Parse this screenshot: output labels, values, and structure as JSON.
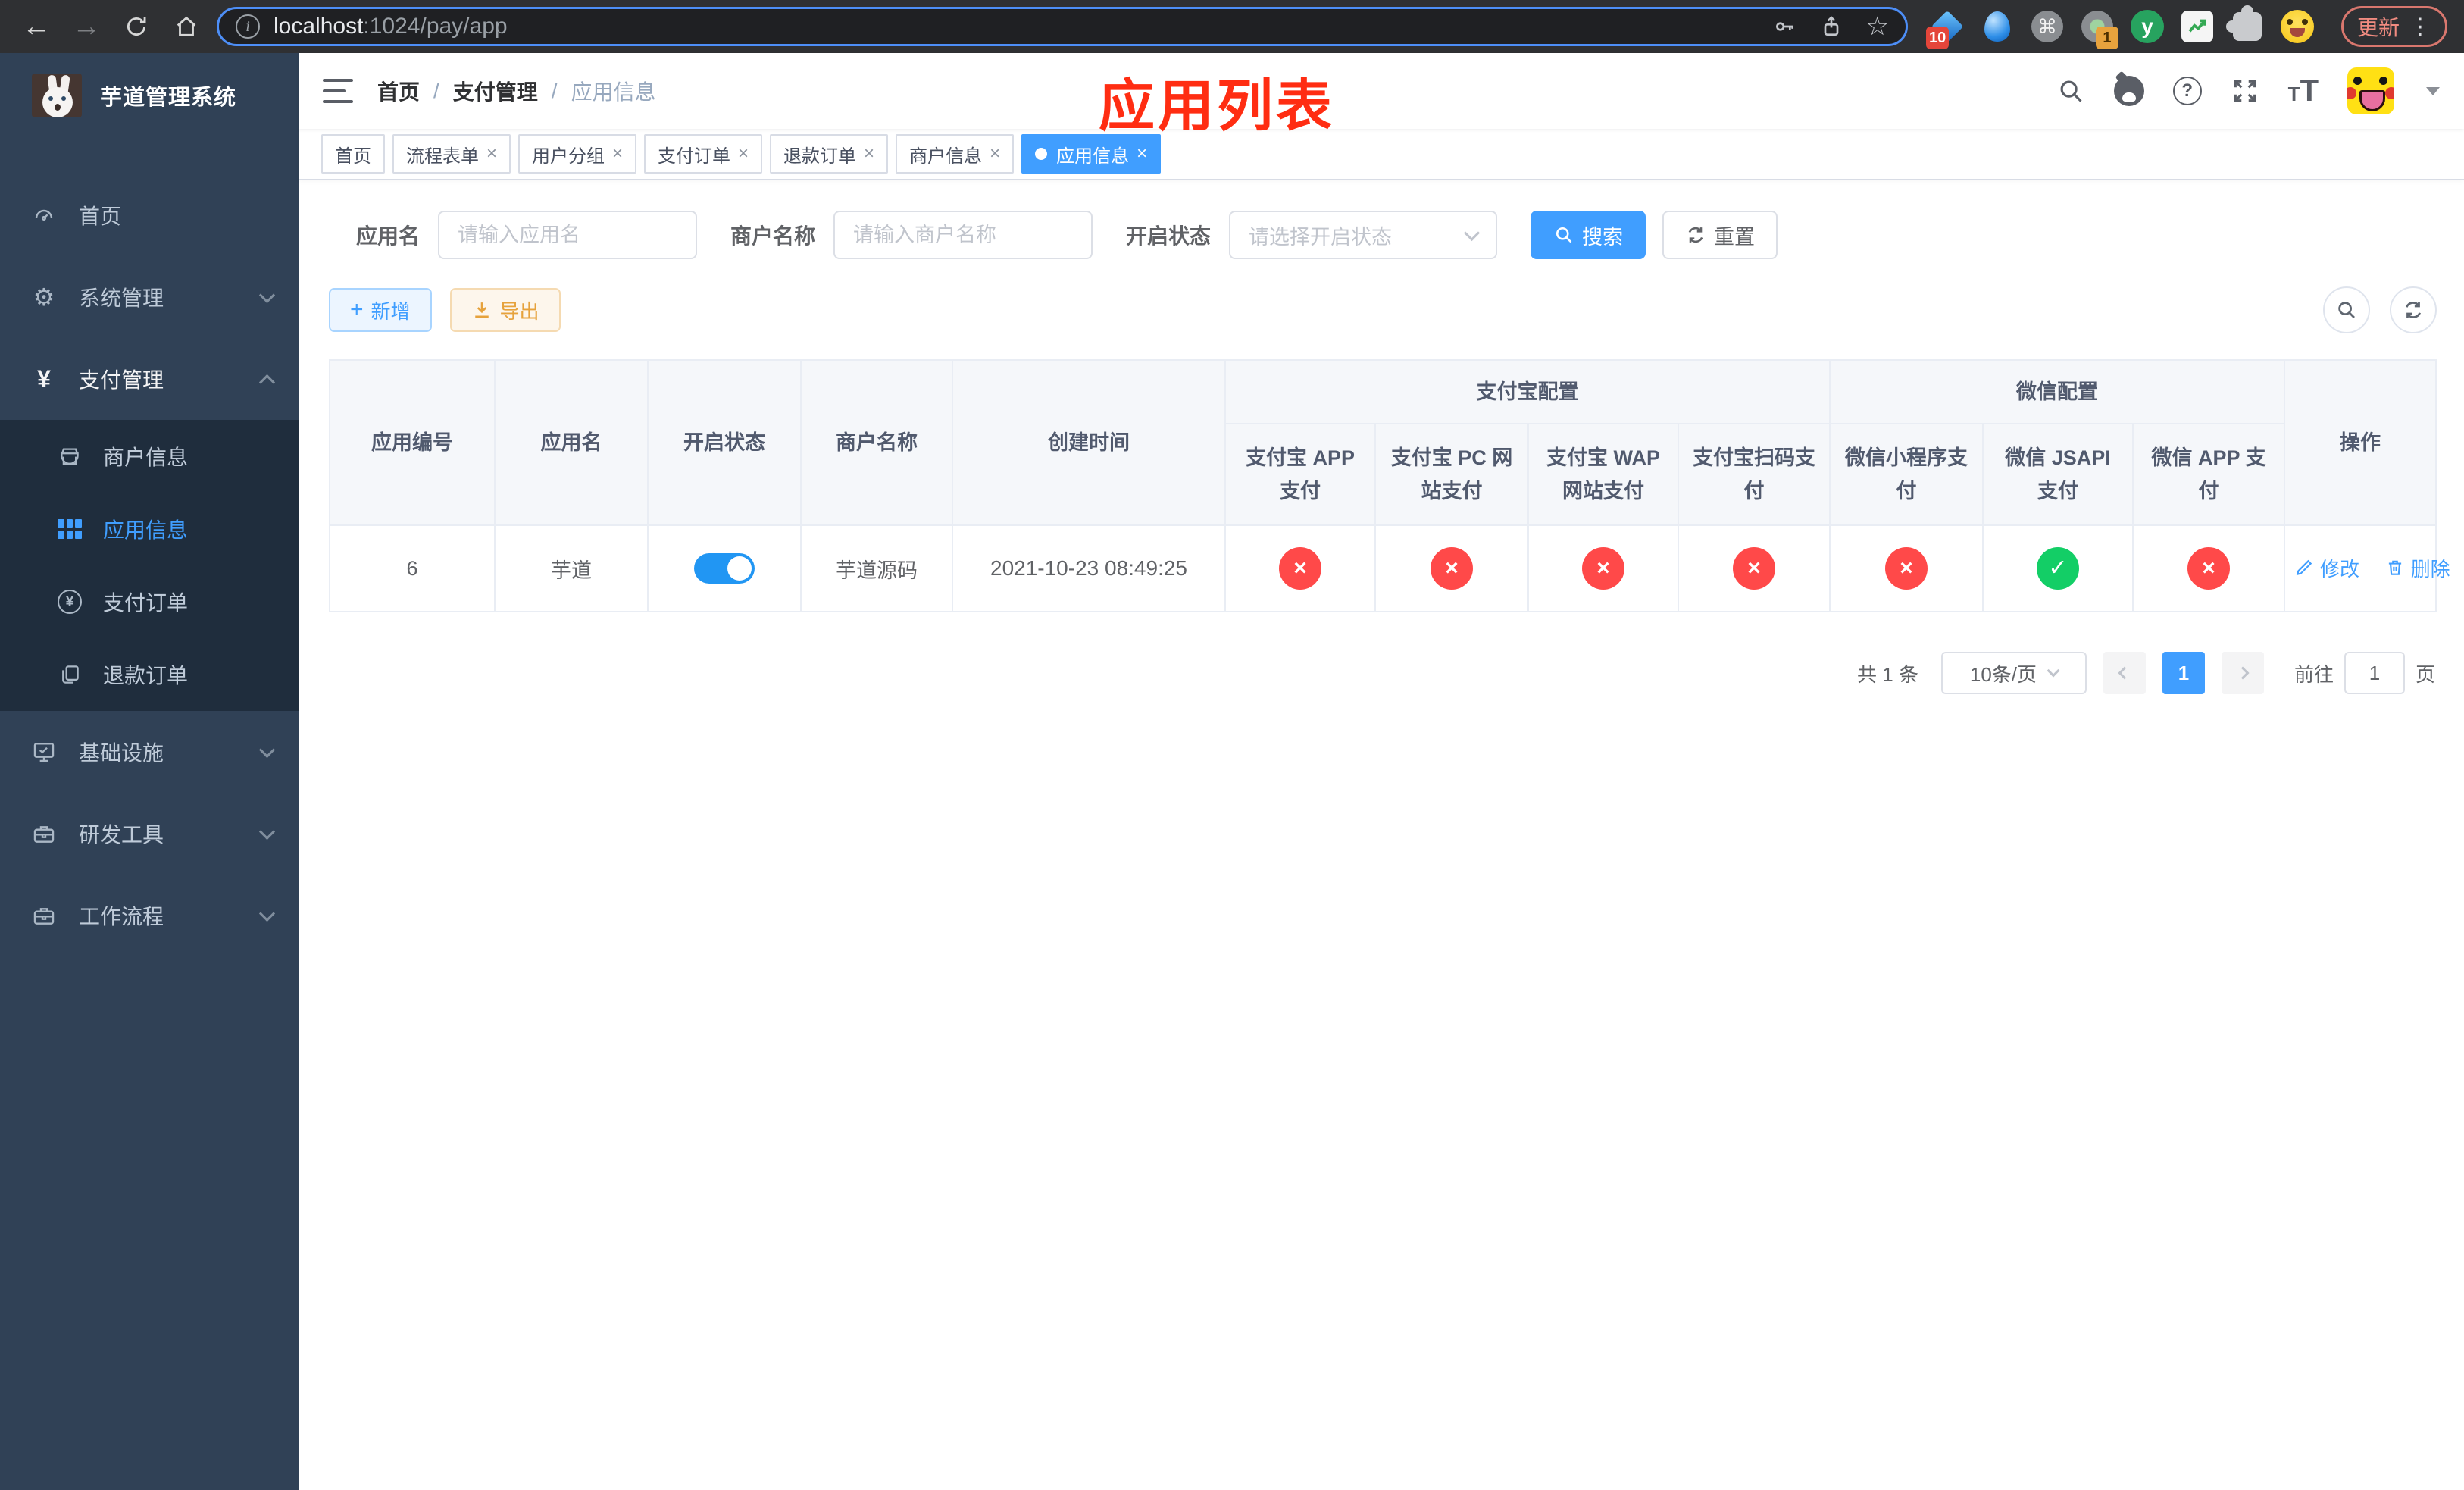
{
  "colors": {
    "primary": "#409eff",
    "success": "#13ce66",
    "danger": "#ff4949",
    "warning": "#e6a23c",
    "annotation_red": "#ff2d12",
    "sidebar_bg": "#304156",
    "submenu_bg": "#1f2d3d"
  },
  "icons": {
    "back": "←",
    "forward": "→",
    "star": "☆",
    "info": "i",
    "command": "⌘",
    "kebab": "⋮",
    "gear": "⚙",
    "yuan": "¥",
    "close": "×",
    "check": "✓",
    "cross": "×",
    "slash": "/",
    "question": "?",
    "plus": "+",
    "letter_y": "y",
    "font_small": "T",
    "font_big": "T"
  },
  "browser": {
    "url_host": "localhost",
    "url_rest": ":1024/pay/app",
    "ext_badge_1": "10",
    "ext_badge_2": "1",
    "update_button": "更新"
  },
  "sidebar": {
    "title": "芋道管理系统",
    "menu": [
      {
        "label": "首页"
      },
      {
        "label": "系统管理"
      },
      {
        "label": "支付管理"
      },
      {
        "label": "商户信息"
      },
      {
        "label": "应用信息"
      },
      {
        "label": "支付订单"
      },
      {
        "label": "退款订单"
      },
      {
        "label": "基础设施"
      },
      {
        "label": "研发工具"
      },
      {
        "label": "工作流程"
      }
    ]
  },
  "header": {
    "breadcrumb": [
      "首页",
      "支付管理",
      "应用信息"
    ],
    "annotation": "应用列表"
  },
  "tabs": [
    {
      "label": "首页"
    },
    {
      "label": "流程表单"
    },
    {
      "label": "用户分组"
    },
    {
      "label": "支付订单"
    },
    {
      "label": "退款订单"
    },
    {
      "label": "商户信息"
    },
    {
      "label": "应用信息"
    }
  ],
  "filters": {
    "app_name_label": "应用名",
    "app_name_placeholder": "请输入应用名",
    "merchant_label": "商户名称",
    "merchant_placeholder": "请输入商户名称",
    "status_label": "开启状态",
    "status_placeholder": "请选择开启状态",
    "search_button": "搜索",
    "reset_button": "重置"
  },
  "toolbar": {
    "add_button": "新增",
    "export_button": "导出"
  },
  "table": {
    "simple_columns": [
      "应用编号",
      "应用名",
      "开启状态",
      "商户名称",
      "创建时间"
    ],
    "groups": {
      "alipay": "支付宝配置",
      "wechat": "微信配置"
    },
    "pay_columns": [
      "支付宝 APP 支付",
      "支付宝 PC 网站支付",
      "支付宝 WAP 网站支付",
      "支付宝扫码支付",
      "微信小程序支付",
      "微信 JSAPI 支付",
      "微信 APP 支付"
    ],
    "actions_column": "操作",
    "row": {
      "app_id": "6",
      "app_name": "芋道",
      "enabled": true,
      "merchant": "芋道源码",
      "created_at": "2021-10-23 08:49:25",
      "pay_status": [
        "fail",
        "fail",
        "fail",
        "fail",
        "fail",
        "pass",
        "fail"
      ],
      "edit_label": "修改",
      "delete_label": "删除"
    }
  },
  "pagination": {
    "total": "共 1 条",
    "page_size": "10条/页",
    "current_page": "1",
    "goto_label": "前往",
    "goto_value": "1",
    "page_suffix": "页"
  }
}
